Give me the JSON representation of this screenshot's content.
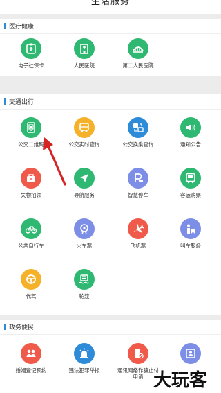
{
  "page": {
    "title": "生活服务"
  },
  "colors": {
    "green": "#2eb872",
    "orange": "#f6b12a",
    "blue": "#2e8bd8",
    "red": "#ef5a4a",
    "lavender": "#7d8ee6",
    "accent": "#2e8bd8",
    "arrow": "#d62424"
  },
  "sections": [
    {
      "title": "医疗健康",
      "items": [
        {
          "label": "电子社保卡",
          "icon": "medical-card-icon"
        },
        {
          "label": "人民医院",
          "icon": "hospital-icon"
        },
        {
          "label": "第二人民医院",
          "icon": "hospital-arch-icon"
        }
      ]
    },
    {
      "title": "交通出行",
      "items": [
        {
          "label": "公交二维码",
          "icon": "qr-code-icon"
        },
        {
          "label": "公交实时查询",
          "icon": "bus-realtime-icon"
        },
        {
          "label": "公交换乘查询",
          "icon": "bus-transfer-icon"
        },
        {
          "label": "通知公告",
          "icon": "speaker-icon"
        },
        {
          "label": "失物招领",
          "icon": "lost-found-icon"
        },
        {
          "label": "导航服务",
          "icon": "navigation-icon"
        },
        {
          "label": "智慧停车",
          "icon": "parking-icon"
        },
        {
          "label": "客运购票",
          "icon": "coach-ticket-icon"
        },
        {
          "label": "公共自行车",
          "icon": "bicycle-icon"
        },
        {
          "label": "火车票",
          "icon": "train-icon"
        },
        {
          "label": "飞机票",
          "icon": "airplane-icon"
        },
        {
          "label": "叫车服务",
          "icon": "taxi-icon"
        },
        {
          "label": "代驾",
          "icon": "steering-wheel-icon"
        },
        {
          "label": "轮渡",
          "icon": "ferry-icon"
        }
      ]
    },
    {
      "title": "政务便民",
      "items": [
        {
          "label": "婚姻登记预约",
          "icon": "marriage-icon"
        },
        {
          "label": "违法犯罪举报",
          "icon": "police-light-icon"
        },
        {
          "label": "通讯网络诈骗止付申请",
          "icon": "phone-fraud-icon"
        },
        {
          "label": "",
          "icon": "person-id-icon"
        }
      ]
    }
  ],
  "watermark": {
    "text": "大玩客"
  }
}
